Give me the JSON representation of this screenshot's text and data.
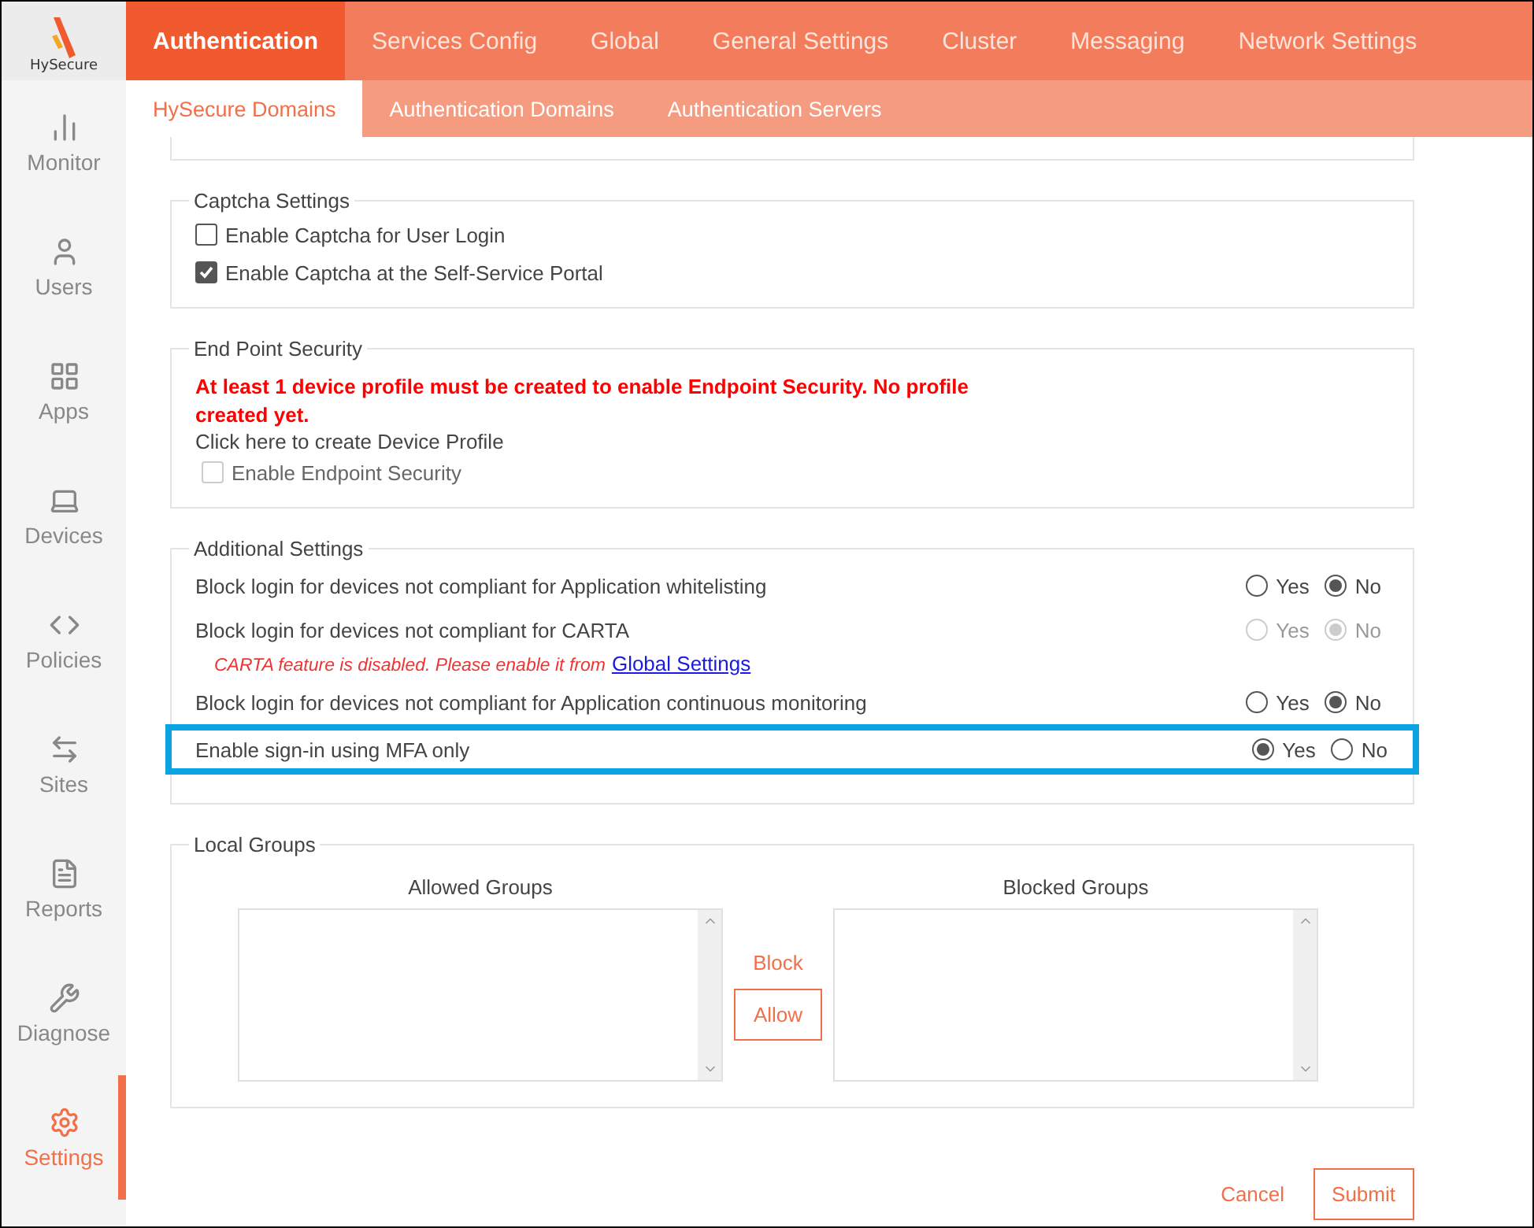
{
  "logo": {
    "text": "HySecure"
  },
  "sidebar": {
    "items": [
      {
        "label": "Monitor",
        "kind": "chart",
        "selected": false
      },
      {
        "label": "Users",
        "kind": "user",
        "selected": false
      },
      {
        "label": "Apps",
        "kind": "apps",
        "selected": false
      },
      {
        "label": "Devices",
        "kind": "laptop",
        "selected": false
      },
      {
        "label": "Policies",
        "kind": "code",
        "selected": false
      },
      {
        "label": "Sites",
        "kind": "arrows",
        "selected": false
      },
      {
        "label": "Reports",
        "kind": "report",
        "selected": false
      },
      {
        "label": "Diagnose",
        "kind": "wrench",
        "selected": false
      },
      {
        "label": "Settings",
        "kind": "gear",
        "selected": true
      }
    ]
  },
  "tabs": [
    {
      "label": "Authentication",
      "selected": true
    },
    {
      "label": "Services Config",
      "selected": false
    },
    {
      "label": "Global",
      "selected": false
    },
    {
      "label": "General Settings",
      "selected": false
    },
    {
      "label": "Cluster",
      "selected": false
    },
    {
      "label": "Messaging",
      "selected": false
    },
    {
      "label": "Network Settings",
      "selected": false
    }
  ],
  "subtabs": [
    {
      "label": "HySecure Domains",
      "selected": true
    },
    {
      "label": "Authentication Domains",
      "selected": false
    },
    {
      "label": "Authentication Servers",
      "selected": false
    }
  ],
  "captcha": {
    "title": "Captcha Settings",
    "options": [
      {
        "label": "Enable Captcha for User Login",
        "checked": false
      },
      {
        "label": "Enable Captcha at the Self-Service Portal",
        "checked": true
      }
    ]
  },
  "endpoint": {
    "title": "End Point Security",
    "warning": "At least 1 device profile must be created to enable Endpoint Security. No profile created yet.",
    "link": "Click here to create Device Profile",
    "option": {
      "label": "Enable Endpoint Security",
      "checked": false,
      "disabled": true
    }
  },
  "additional": {
    "title": "Additional Settings",
    "rows": [
      {
        "label": "Block login for devices not compliant for Application whitelisting",
        "disabled": false,
        "highlighted": false,
        "options": [
          {
            "label": "Yes",
            "selected": false
          },
          {
            "label": "No",
            "selected": true
          }
        ]
      },
      {
        "label": "Block login for devices not compliant for CARTA",
        "disabled": true,
        "highlighted": false,
        "options": [
          {
            "label": "Yes",
            "selected": false
          },
          {
            "label": "No",
            "selected": true
          }
        ],
        "note": "CARTA feature is disabled. Please enable it from",
        "note_link": "Global Settings"
      },
      {
        "label": "Block login for devices not compliant for Application continuous monitoring",
        "disabled": false,
        "highlighted": false,
        "options": [
          {
            "label": "Yes",
            "selected": false
          },
          {
            "label": "No",
            "selected": true
          }
        ]
      },
      {
        "label": "Enable sign-in using MFA only",
        "disabled": false,
        "highlighted": true,
        "options": [
          {
            "label": "Yes",
            "selected": true
          },
          {
            "label": "No",
            "selected": false
          }
        ]
      }
    ]
  },
  "groups": {
    "title": "Local Groups",
    "allowed_title": "Allowed Groups",
    "blocked_title": "Blocked Groups",
    "block_label": "Block",
    "allow_label": "Allow"
  },
  "actions": {
    "cancel": "Cancel",
    "submit": "Submit"
  }
}
